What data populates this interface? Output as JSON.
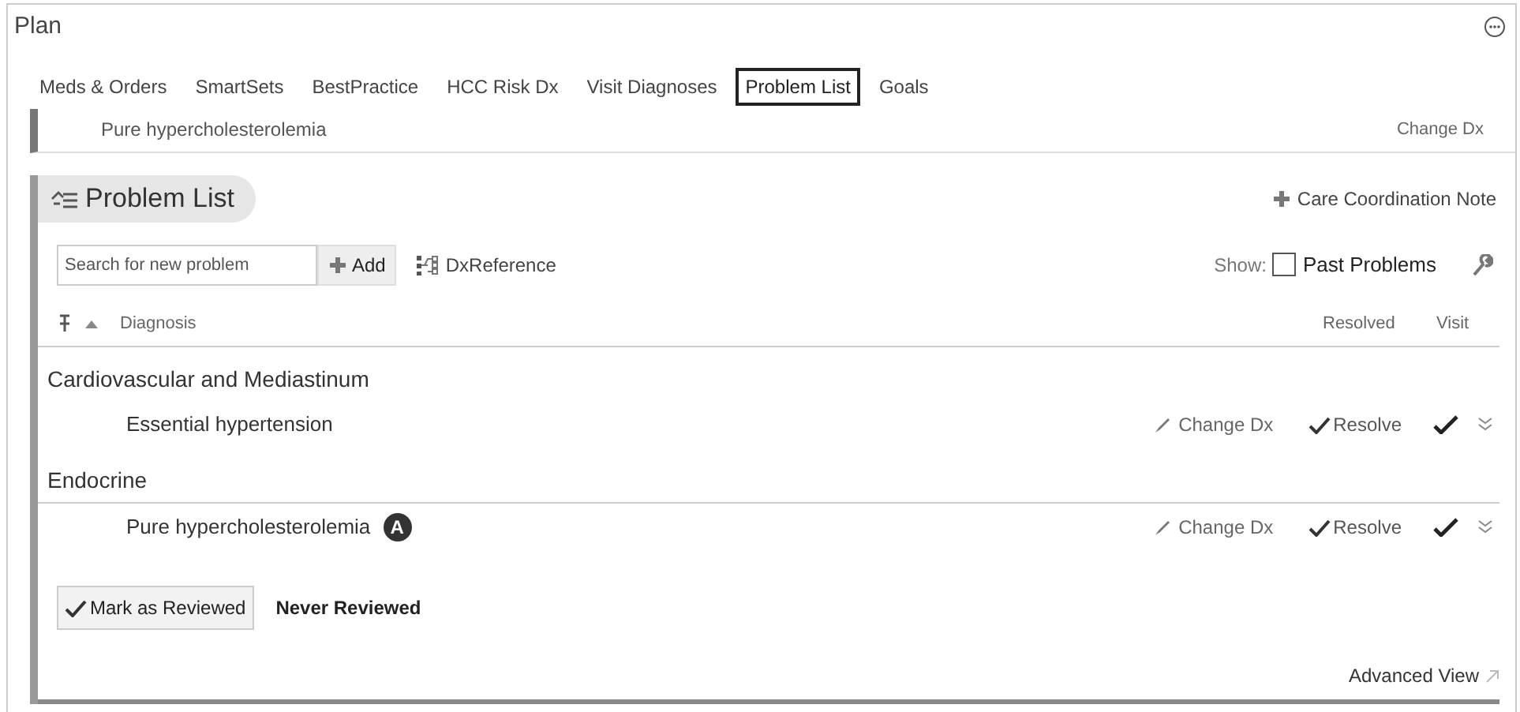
{
  "window": {
    "title": "Plan"
  },
  "tabs": [
    {
      "label": "Meds & Orders",
      "selected": false
    },
    {
      "label": "SmartSets",
      "selected": false
    },
    {
      "label": "BestPractice",
      "selected": false
    },
    {
      "label": "HCC Risk Dx",
      "selected": false
    },
    {
      "label": "Visit Diagnoses",
      "selected": false
    },
    {
      "label": "Problem List",
      "selected": true
    },
    {
      "label": "Goals",
      "selected": false
    }
  ],
  "previous_section_row": {
    "diagnosis": "Pure hypercholesterolemia",
    "action": "Change Dx"
  },
  "problem_list": {
    "title": "Problem List",
    "care_note": "Care Coordination Note",
    "search": {
      "placeholder": "Search for new problem"
    },
    "add_button": "Add",
    "reference_link": "DxReference",
    "show_label": "Show:",
    "past_problems": {
      "label": "Past Problems",
      "checked": false
    },
    "columns": [
      "Diagnosis",
      "Resolved",
      "Visit"
    ],
    "groups": [
      {
        "name": "Cardiovascular and Mediastinum",
        "problems": [
          {
            "diagnosis": "Essential hypertension",
            "change": "Change Dx",
            "resolve": "Resolve",
            "visit_checked": true
          }
        ]
      },
      {
        "name": "Endocrine",
        "problems": [
          {
            "diagnosis": "Pure hypercholesterolemia",
            "badge": "A",
            "change": "Change Dx",
            "resolve": "Resolve",
            "visit_checked": true
          }
        ]
      }
    ],
    "review_button": "Mark as Reviewed",
    "review_status": "Never Reviewed",
    "advanced_view": "Advanced View"
  }
}
